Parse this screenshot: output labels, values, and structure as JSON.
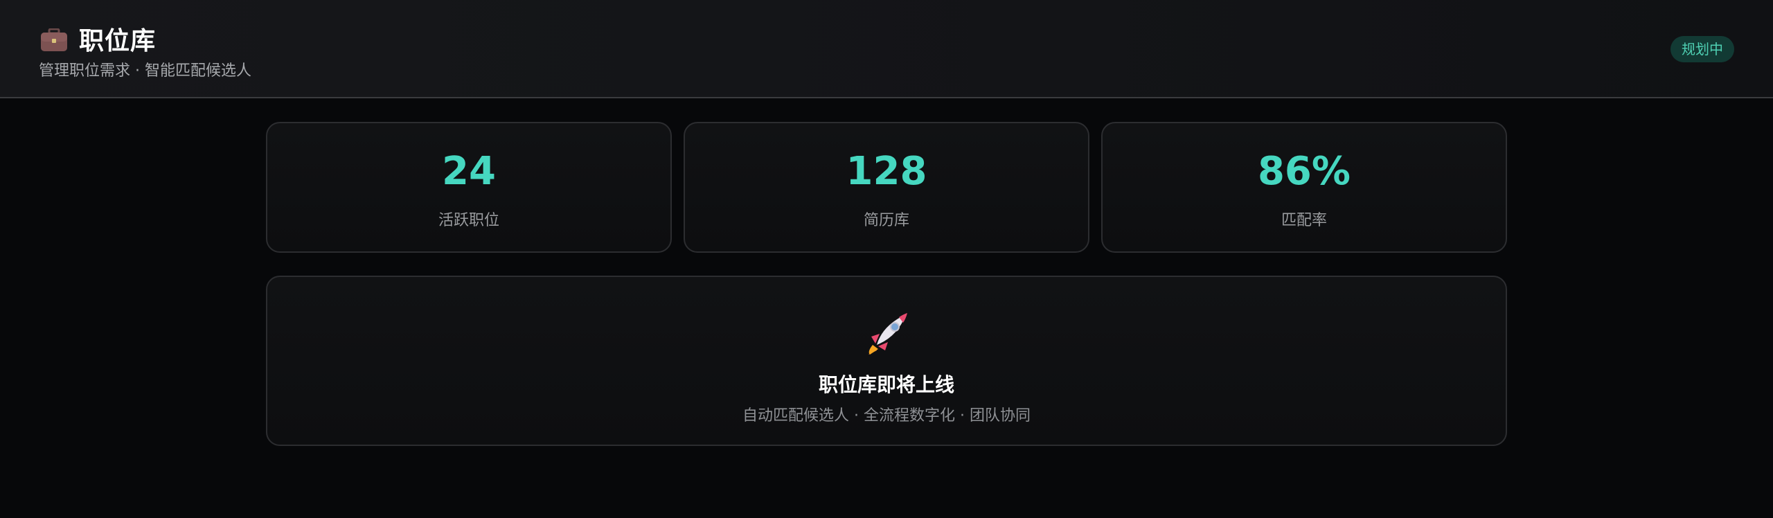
{
  "header": {
    "title": "职位库",
    "subtitle": "管理职位需求 · 智能匹配候选人",
    "status_badge": "规划中",
    "icon": "briefcase-icon"
  },
  "stats": [
    {
      "value": "24",
      "label": "活跃职位"
    },
    {
      "value": "128",
      "label": "简历库"
    },
    {
      "value": "86%",
      "label": "匹配率"
    }
  ],
  "coming_soon": {
    "icon": "rocket-icon",
    "title": "职位库即将上线",
    "subtitle": "自动匹配候选人 · 全流程数字化 · 团队协同"
  },
  "colors": {
    "accent": "#46d7c0",
    "badge_bg": "#123a34",
    "badge_text": "#4fd1b4",
    "background": "#07080a"
  }
}
